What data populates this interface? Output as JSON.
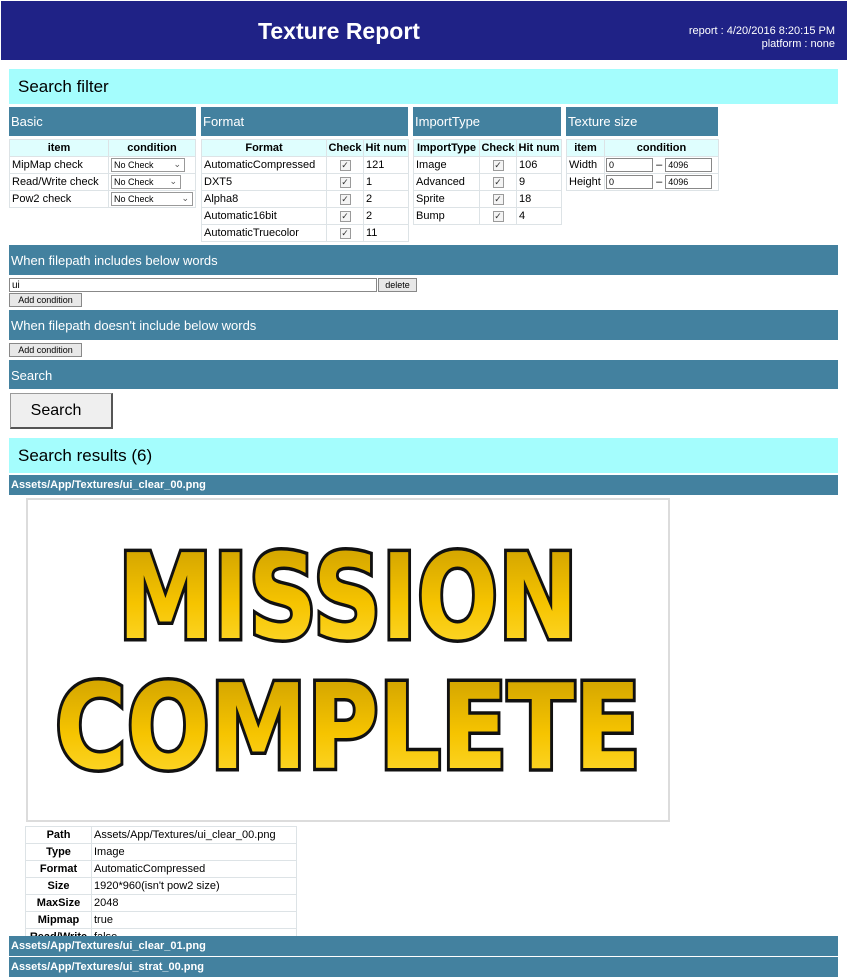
{
  "header": {
    "title": "Texture Report",
    "report": "report : 4/20/2016 8:20:15 PM",
    "platform": "platform : none"
  },
  "search_filter": {
    "title": "Search filter",
    "basic": {
      "title": "Basic",
      "columns": [
        "item",
        "condition"
      ],
      "rows": [
        {
          "item": "MipMap check",
          "condition": "No Check"
        },
        {
          "item": "Read/Write check",
          "condition": "No Check"
        },
        {
          "item": "Pow2 check",
          "condition": "No Check"
        }
      ]
    },
    "format": {
      "title": "Format",
      "columns": [
        "Format",
        "Check",
        "Hit num"
      ],
      "rows": [
        {
          "name": "AutomaticCompressed",
          "checked": true,
          "hits": "121"
        },
        {
          "name": "DXT5",
          "checked": true,
          "hits": "1"
        },
        {
          "name": "Alpha8",
          "checked": true,
          "hits": "2"
        },
        {
          "name": "Automatic16bit",
          "checked": true,
          "hits": "2"
        },
        {
          "name": "AutomaticTruecolor",
          "checked": true,
          "hits": "11"
        }
      ]
    },
    "import_type": {
      "title": "ImportType",
      "columns": [
        "ImportType",
        "Check",
        "Hit num"
      ],
      "rows": [
        {
          "name": "Image",
          "checked": true,
          "hits": "106"
        },
        {
          "name": "Advanced",
          "checked": true,
          "hits": "9"
        },
        {
          "name": "Sprite",
          "checked": true,
          "hits": "18"
        },
        {
          "name": "Bump",
          "checked": true,
          "hits": "4"
        }
      ]
    },
    "texture_size": {
      "title": "Texture size",
      "columns": [
        "item",
        "condition"
      ],
      "dash": "–",
      "rows": [
        {
          "item": "Width",
          "min": "0",
          "max": "4096"
        },
        {
          "item": "Height",
          "min": "0",
          "max": "4096"
        }
      ]
    }
  },
  "include_words": {
    "title": "When filepath includes below words",
    "value": "ui",
    "delete_label": "delete",
    "add_label": "Add condition"
  },
  "exclude_words": {
    "title": "When filepath doesn't include below words",
    "add_label": "Add condition"
  },
  "search": {
    "title": "Search",
    "button_label": "Search"
  },
  "results": {
    "title": "Search results (6)",
    "items": [
      {
        "path": "Assets/App/Textures/ui_clear_00.png"
      },
      {
        "path": "Assets/App/Textures/ui_clear_01.png"
      },
      {
        "path": "Assets/App/Textures/ui_strat_00.png"
      }
    ],
    "preview_text": {
      "line1": "MISSION",
      "line2": "COMPLETE"
    },
    "details": [
      {
        "key": "Path",
        "value": "Assets/App/Textures/ui_clear_00.png"
      },
      {
        "key": "Type",
        "value": "Image"
      },
      {
        "key": "Format",
        "value": "AutomaticCompressed"
      },
      {
        "key": "Size",
        "value": "1920*960(isn't pow2 size)"
      },
      {
        "key": "MaxSize",
        "value": "2048"
      },
      {
        "key": "Mipmap",
        "value": "true"
      },
      {
        "key": "Read/Write",
        "value": "false"
      }
    ]
  },
  "colors": {
    "header_bg": "#1f2286",
    "section_cyan": "#a4fdfd",
    "bar_blue": "#43819f",
    "logo_gold": "#f2c200",
    "logo_outline": "#111111"
  },
  "icons": {
    "checkbox": "check-mark",
    "select_arrow": "chevron-down"
  }
}
